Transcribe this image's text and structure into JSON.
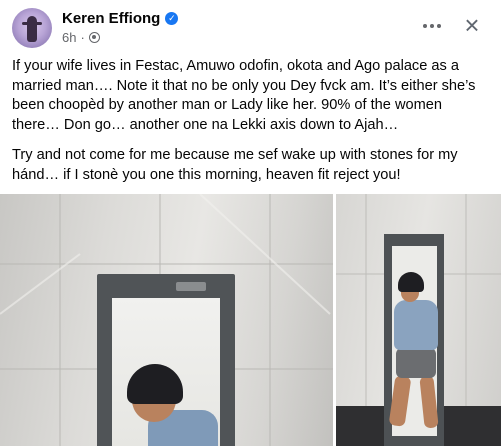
{
  "post": {
    "author": {
      "name": "Keren Effiong",
      "time": "6h",
      "separator": "·"
    },
    "paragraphs": [
      "If your wife lives in Festac, Amuwo odofin, okota and Ago palace as a married man…. Note it that no be only you Dey fvck am. It’s either she’s been choopèd by another man or Lady like her. 90% of the women there… Don go… another one na Lekki axis down to Ajah…",
      "Try and not come for me because me sef wake up with stones for my hánd… if I stonè you one this morning, heaven fit reject you!"
    ],
    "icons": {
      "verified": "verified-badge-icon",
      "audience": "globe-icon",
      "more": "more-options-icon",
      "close": "close-icon"
    },
    "colors": {
      "verified": "#1877f2",
      "meta_text": "#65676b"
    },
    "verified_glyph": "✓",
    "close_glyph": "×"
  }
}
